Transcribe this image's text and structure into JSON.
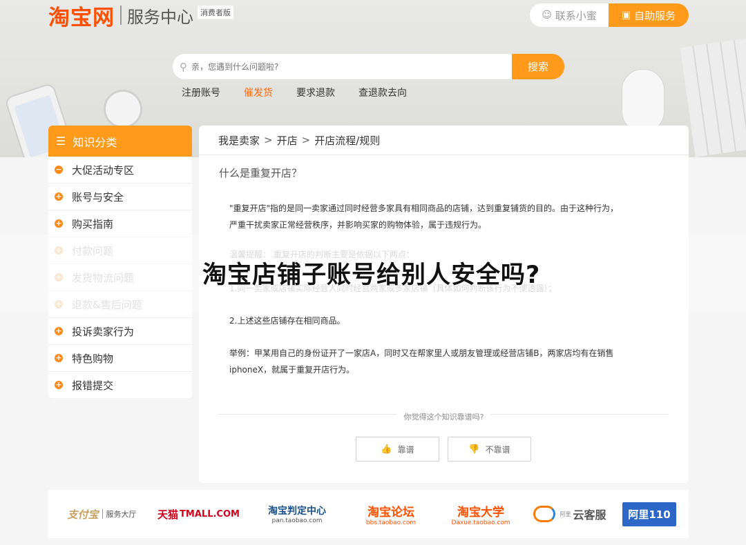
{
  "header": {
    "brand": "淘宝网",
    "service": "服务中心",
    "edition": "消费者版",
    "contact_label": "联系小蜜",
    "self_service_label": "自助服务"
  },
  "search": {
    "placeholder": "亲，您遇到什么问题啦?",
    "button_label": "搜索"
  },
  "hotlinks": [
    {
      "label": "注册账号"
    },
    {
      "label": "催发货"
    },
    {
      "label": "要求退款"
    },
    {
      "label": "查退款去向"
    }
  ],
  "sidebar": {
    "title": "知识分类",
    "items": [
      {
        "label": "大促活动专区",
        "mark": "−"
      },
      {
        "label": "账号与安全",
        "mark": "+"
      },
      {
        "label": "购买指南",
        "mark": "+"
      },
      {
        "label": "付款问题",
        "mark": "+"
      },
      {
        "label": "发货物流问题",
        "mark": "+"
      },
      {
        "label": "退款&售后问题",
        "mark": "+"
      },
      {
        "label": "投诉卖家行为",
        "mark": "+"
      },
      {
        "label": "特色购物",
        "mark": "+"
      },
      {
        "label": "报错提交",
        "mark": "+"
      }
    ]
  },
  "breadcrumb": {
    "items": [
      "我是卖家",
      "开店",
      "开店流程/规则"
    ],
    "separator": ">"
  },
  "article": {
    "question": "什么是重复开店？",
    "p1_line1": "\"重复开店\"指的是同一卖家通过同时经营多家具有相同商品的店铺，达到重复铺货的目的。由于这种行为，",
    "p1_line2": "严重干扰卖家正常经营秩序，并影响买家的购物体验，属于违规行为。",
    "tip": "温馨提醒：  重复开店的判断主要是依据以下两点：",
    "point1": "1.同一卖家或店铺实际经营人同时经营两家或多家店铺（具体如何判断该行为不便透露）；",
    "point2": "2.上述这些店铺存在相同商品。",
    "example_line1": "举例：甲某用自己的身份证开了一家店A，同时又在帮家里人或朋友管理或经营店铺B，两家店均有在销售",
    "example_line2": "iphoneX，就属于重复开店行为。"
  },
  "feedback": {
    "question": "你觉得这个知识靠谱吗?",
    "yes_label": "靠谱",
    "no_label": "不靠谱"
  },
  "footer": {
    "logos": [
      {
        "main": "支付宝",
        "sub": "服务大厅"
      },
      {
        "main": "天猫",
        "sub": "TMALL.COM"
      },
      {
        "main": "淘宝判定中心",
        "sub": "pan.taobao.com"
      },
      {
        "main": "淘宝论坛",
        "sub": "bbs.taobao.com"
      },
      {
        "main": "淘宝大学",
        "sub": "Daxue.taobao.com"
      },
      {
        "main": "云客服",
        "sub": "阿里"
      },
      {
        "main": "阿里110",
        "sub": ""
      }
    ]
  },
  "overlay_title": "淘宝店铺子账号给别人安全吗?",
  "colors": {
    "brand": "#ff5000",
    "accent": "#ff9a1a",
    "active_link": "#ff6a00"
  }
}
